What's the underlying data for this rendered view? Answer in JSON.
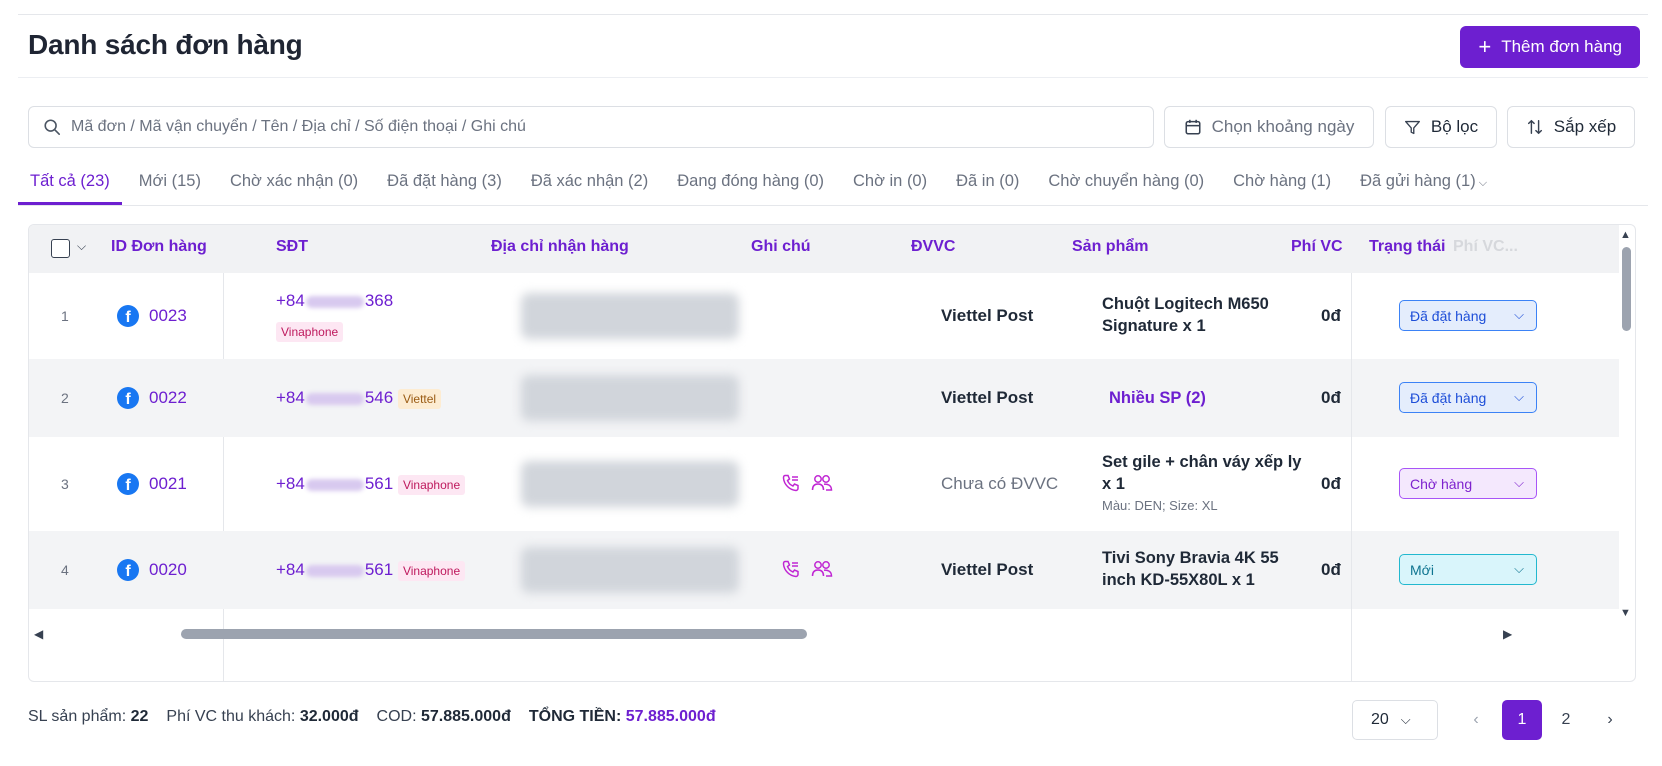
{
  "header": {
    "title": "Danh sách đơn hàng",
    "add_button": "Thêm đơn hàng"
  },
  "toolbar": {
    "search_placeholder": "Mã đơn / Mã vận chuyển / Tên / Địa chỉ / Số điện thoại / Ghi chú",
    "date_placeholder": "Chọn khoảng ngày",
    "filter_label": "Bộ lọc",
    "sort_label": "Sắp xếp"
  },
  "tabs": [
    {
      "label": "Tất cả (23)",
      "active": true
    },
    {
      "label": "Mới (15)"
    },
    {
      "label": "Chờ xác nhận (0)"
    },
    {
      "label": "Đã đặt hàng (3)"
    },
    {
      "label": "Đã xác nhận (2)"
    },
    {
      "label": "Đang đóng hàng (0)"
    },
    {
      "label": "Chờ in (0)"
    },
    {
      "label": "Đã in (0)"
    },
    {
      "label": "Chờ chuyển hàng (0)"
    },
    {
      "label": "Chờ hàng (1)"
    },
    {
      "label": "Đã gửi hàng (1)"
    }
  ],
  "table": {
    "columns": {
      "id": "ID Đơn hàng",
      "phone": "SĐT",
      "address": "Địa chỉ nhận hàng",
      "note": "Ghi chú",
      "dvvc": "ĐVVC",
      "product": "Sản phẩm",
      "fee": "Phí VC",
      "status": "Trạng thái",
      "extra": "Phí VC..."
    },
    "rows": [
      {
        "index": "1",
        "id": "0023",
        "phone_prefix": "+84",
        "phone_suffix": "368",
        "carrier": "Vinaphone",
        "dvvc": "Viettel Post",
        "product": "Chuột Logitech M650 Signature x 1",
        "variant": "",
        "fee": "0đ",
        "status": "Đã đặt hàng"
      },
      {
        "index": "2",
        "id": "0022",
        "phone_prefix": "+84",
        "phone_suffix": "546",
        "carrier": "Viettel",
        "dvvc": "Viettel Post",
        "product": "Nhiều SP (2)",
        "variant": "",
        "fee": "0đ",
        "status": "Đã đặt hàng"
      },
      {
        "index": "3",
        "id": "0021",
        "phone_prefix": "+84",
        "phone_suffix": "561",
        "carrier": "Vinaphone",
        "dvvc": "Chưa có ĐVVC",
        "product": "Set gile + chân váy xếp ly x 1",
        "variant": "Màu: DEN; Size: XL",
        "fee": "0đ",
        "status": "Chờ hàng"
      },
      {
        "index": "4",
        "id": "0020",
        "phone_prefix": "+84",
        "phone_suffix": "561",
        "carrier": "Vinaphone",
        "dvvc": "Viettel Post",
        "product": "Tivi Sony Bravia 4K 55 inch KD-55X80L x 1",
        "variant": "",
        "fee": "0đ",
        "status": "Mới"
      }
    ]
  },
  "summary": {
    "qty_label": "SL sản phẩm:",
    "qty": "22",
    "ship_label": "Phí VC thu khách:",
    "ship": "32.000đ",
    "cod_label": "COD:",
    "cod": "57.885.000đ",
    "total_label": "TỔNG TIỀN:",
    "total": "57.885.000đ"
  },
  "pagination": {
    "page_size": "20",
    "pages": [
      "1",
      "2"
    ],
    "current": "1"
  }
}
